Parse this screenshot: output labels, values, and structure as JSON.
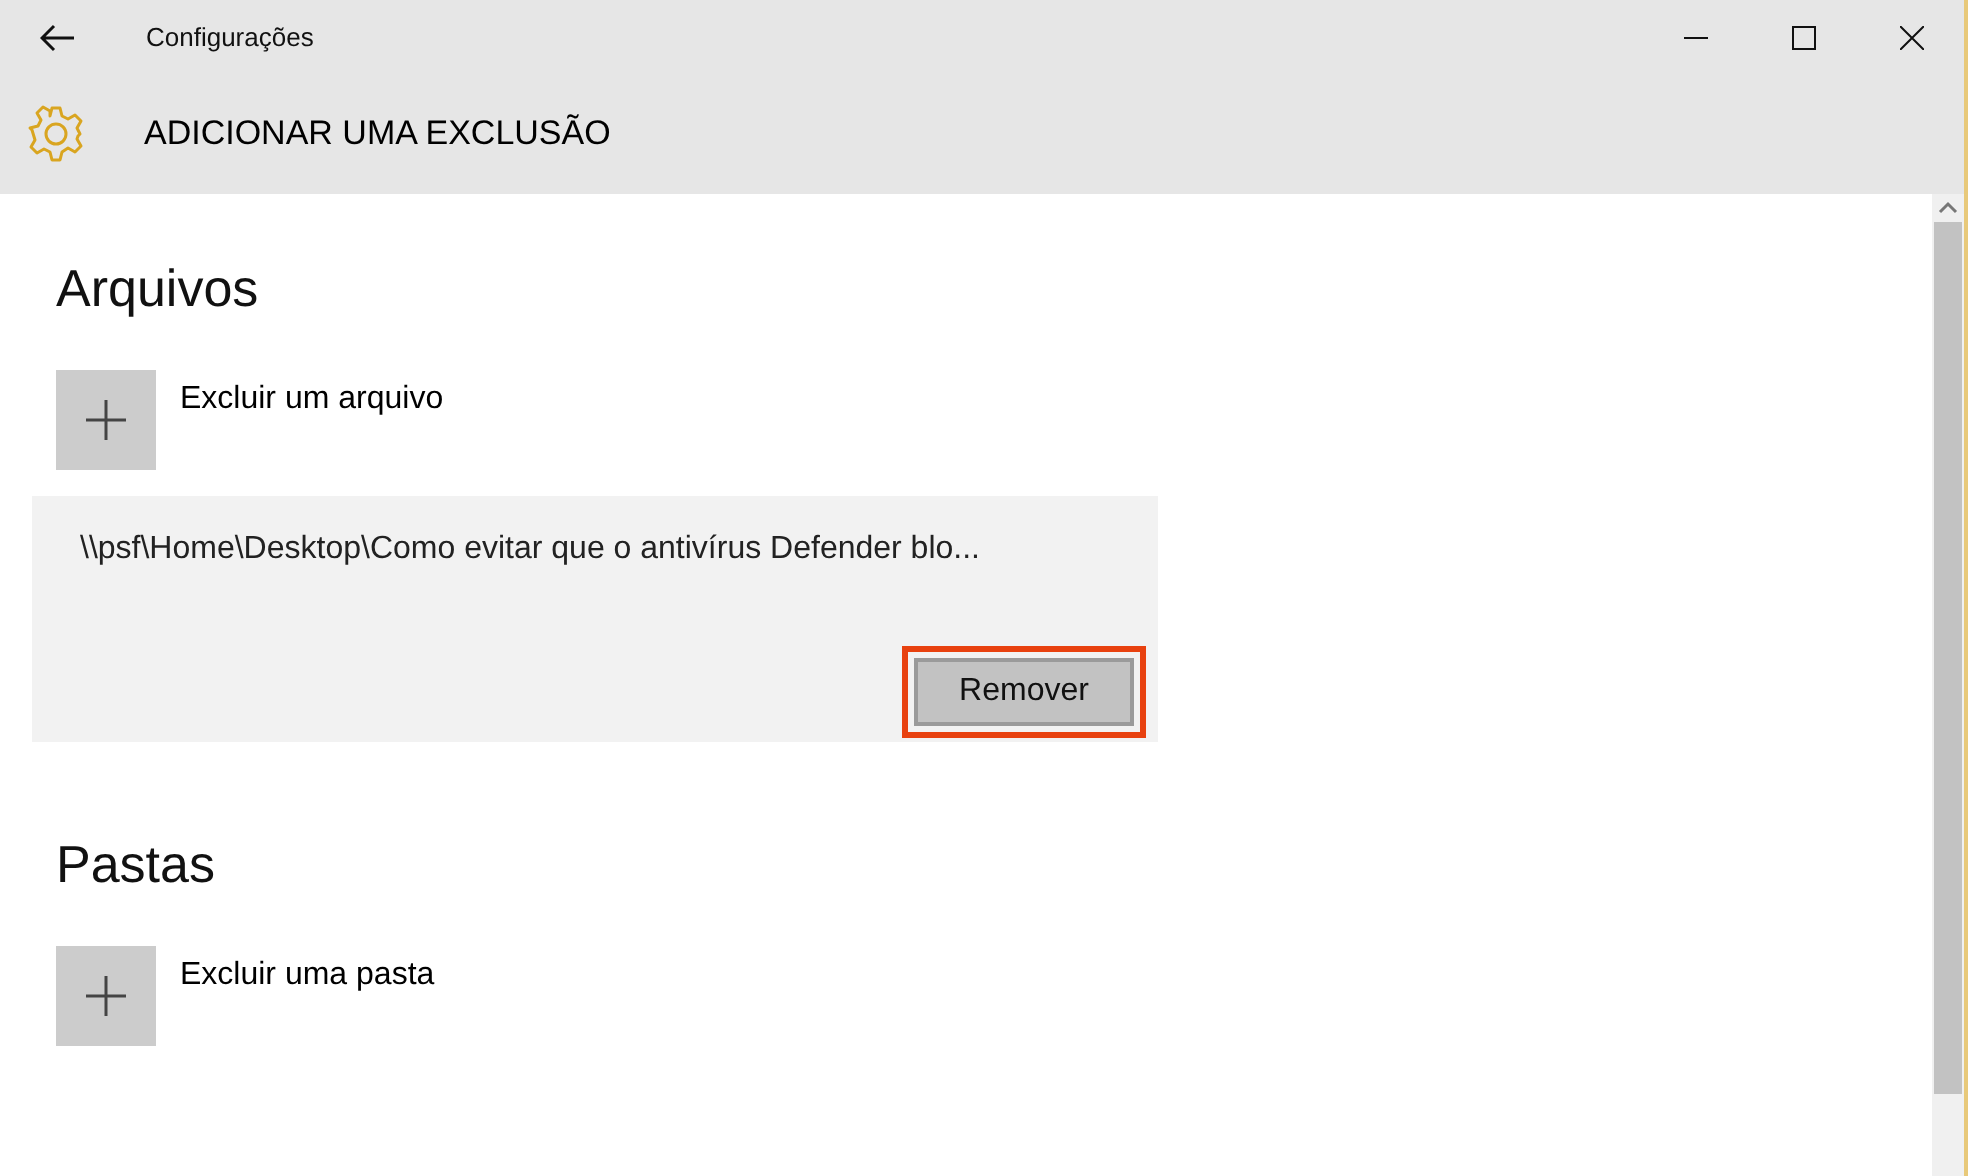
{
  "window": {
    "title": "Configurações"
  },
  "header": {
    "title": "ADICIONAR UMA EXCLUSÃO"
  },
  "sections": [
    {
      "heading": "Arquivos",
      "add_label": "Excluir um arquivo",
      "items": [
        {
          "path": "\\\\psf\\Home\\Desktop\\Como evitar que o antivírus Defender blo...",
          "button": {
            "label": "Remover",
            "highlighted": true
          }
        }
      ]
    },
    {
      "heading": "Pastas",
      "add_label": "Excluir uma pasta"
    }
  ]
}
